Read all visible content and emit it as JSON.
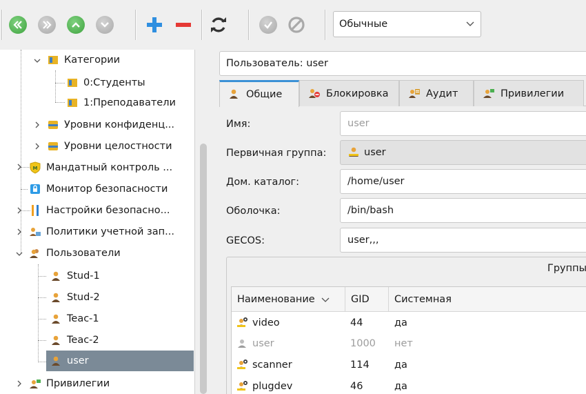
{
  "toolbar": {
    "buttons": [
      {
        "name": "first-icon"
      },
      {
        "name": "last-icon"
      },
      {
        "name": "up-icon"
      },
      {
        "name": "down-icon"
      },
      {
        "name": "add-icon"
      },
      {
        "name": "remove-icon"
      },
      {
        "name": "refresh-icon"
      },
      {
        "name": "apply-icon"
      },
      {
        "name": "cancel-icon"
      }
    ],
    "mode_select": "Обычные"
  },
  "tree": {
    "items": [
      {
        "label": "Категории"
      },
      {
        "label": "0:Студенты"
      },
      {
        "label": "1:Преподаватели"
      },
      {
        "label": "Уровни конфиденц..."
      },
      {
        "label": "Уровни целостности"
      },
      {
        "label": "Мандатный контроль ..."
      },
      {
        "label": "Монитор безопасности"
      },
      {
        "label": "Настройки безопасно..."
      },
      {
        "label": "Политики учетной зап..."
      },
      {
        "label": "Пользователи"
      },
      {
        "label": "Stud-1"
      },
      {
        "label": "Stud-2"
      },
      {
        "label": "Teac-1"
      },
      {
        "label": "Teac-2"
      },
      {
        "label": "user"
      },
      {
        "label": "Привилегии"
      }
    ],
    "selected": "user"
  },
  "panel": {
    "title": "Пользователь: user",
    "tabs": [
      {
        "label": "Общие"
      },
      {
        "label": "Блокировка"
      },
      {
        "label": "Аудит"
      },
      {
        "label": "Привилегии"
      }
    ],
    "fields": {
      "name_label": "Имя:",
      "name_value": "user",
      "group_label": "Первичная группа:",
      "group_value": "user",
      "home_label": "Дом. каталог:",
      "home_value": "/home/user",
      "shell_label": "Оболочка:",
      "shell_value": "/bin/bash",
      "gecos_label": "GECOS:",
      "gecos_value": "user,,,"
    },
    "groups": {
      "title": "Группы",
      "columns": [
        "Наименование",
        "GID",
        "Системная"
      ],
      "rows": [
        {
          "name": "video",
          "gid": "44",
          "system": "да"
        },
        {
          "name": "user",
          "gid": "1000",
          "system": "нет"
        },
        {
          "name": "scanner",
          "gid": "114",
          "system": "да"
        },
        {
          "name": "plugdev",
          "gid": "46",
          "system": "да"
        }
      ]
    }
  },
  "colors": {
    "selection": "#7b8a97",
    "accent": "#3b91d6",
    "green": "#4caf50",
    "red": "#e53935"
  }
}
